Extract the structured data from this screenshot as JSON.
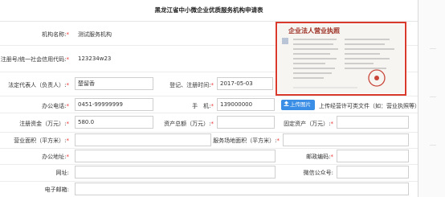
{
  "form": {
    "title": "黑龙江省中小微企业优质服务机构申请表",
    "required_mark": "*",
    "fields": {
      "org_name": {
        "label": "机构名称:",
        "value": "测试服务机构"
      },
      "reg_no": {
        "label": "注册号/统一社会信用代码:",
        "value": "123234w23"
      },
      "legal_rep": {
        "label": "法定代表人（负责人）:",
        "value": "楚留香"
      },
      "reg_time": {
        "label": "登记、注册时间:",
        "value": "2017-05-03"
      },
      "office_phone": {
        "label": "办公电话:",
        "value": "0451-99999999"
      },
      "mobile": {
        "label": "手　机:",
        "value": "139000000"
      },
      "reg_capital": {
        "label": "注册资金（万元）:",
        "value": "580.0"
      },
      "total_assets": {
        "label": "资产总额（万元）:",
        "value": ""
      },
      "fixed_assets": {
        "label": "固定资产（万元）:",
        "value": ""
      },
      "business_area": {
        "label": "营业面积（平方米）:",
        "value": ""
      },
      "service_area": {
        "label": "服务场地面积（平方米）:",
        "value": ""
      },
      "office_address": {
        "label": "办公地址:",
        "value": ""
      },
      "postal_code": {
        "label": "邮政编码:",
        "value": ""
      },
      "website": {
        "label": "网址:",
        "value": ""
      },
      "wechat": {
        "label": "微信公众号:",
        "value": ""
      },
      "email": {
        "label": "电子邮箱:",
        "value": ""
      }
    },
    "license": {
      "heading": "企业法人营业执照"
    },
    "upload": {
      "button_label": "上传图片",
      "icon": "upload-icon",
      "hint": "上传经营许可类文件（如：营业执照等）"
    }
  },
  "colors": {
    "required": "#ee3333",
    "accent": "#3a8ee6",
    "license_border": "#d93a2b"
  }
}
